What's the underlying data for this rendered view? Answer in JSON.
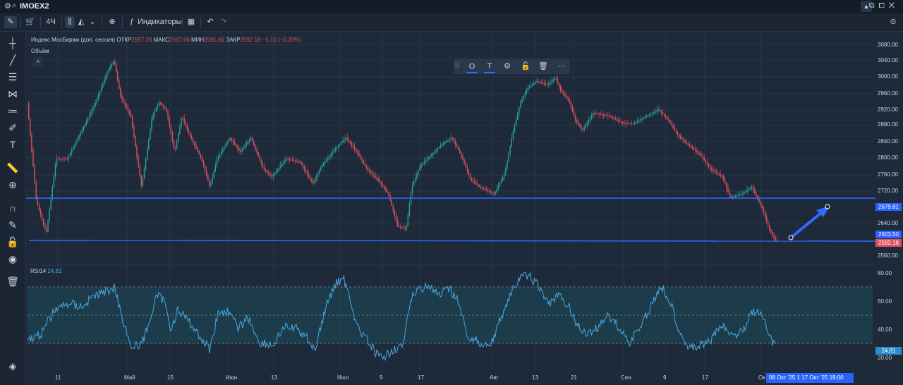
{
  "window": {
    "symbol": "IMOEX2"
  },
  "toolbar": {
    "timeframe": "4Ч",
    "indicators_label": "Индикаторы"
  },
  "legend": {
    "name": "Индекс МосБиржи (доп. сессия)",
    "open_label": "ОТКР",
    "open": "2597.28",
    "high_label": "МАКС",
    "high": "2597.66",
    "low_label": "МИН",
    "low": "2591.61",
    "close_label": "ЗАКР",
    "close": "2592.18",
    "change": "−5.10 (−0.20%)",
    "volume_label": "Объём"
  },
  "rsi": {
    "label": "RSI14",
    "value": "24.81",
    "axis": [
      "80.00",
      "60.00",
      "40.00",
      "20.00"
    ]
  },
  "price_axis": [
    "3080.00",
    "3040.00",
    "3000.00",
    "2960.00",
    "2920.00",
    "2880.00",
    "2840.00",
    "2800.00",
    "2760.00",
    "2720.00",
    "2640.00",
    "2560.00"
  ],
  "price_boxes": {
    "upper_line": "2679.81",
    "lower_line": "2603.50",
    "last": "2592.18"
  },
  "time_axis": [
    "11",
    "Май",
    "15",
    "Июн",
    "13",
    "Июл",
    "9",
    "17",
    "Авг",
    "13",
    "21",
    "Сен",
    "9",
    "17",
    "Ок"
  ],
  "crosshair_time": "08 Окт '25   1  17 Окт '25   19:00",
  "colors": {
    "up": "#26a69a",
    "down": "#e0525e",
    "accent": "#2962ff",
    "rsi": "#4aa8e0"
  },
  "icons": {
    "float_toolbar": [
      "drag-handle-icon",
      "fill-color-icon",
      "text-color-icon",
      "settings-icon",
      "lock-icon",
      "trash-icon",
      "more-icon"
    ]
  }
}
